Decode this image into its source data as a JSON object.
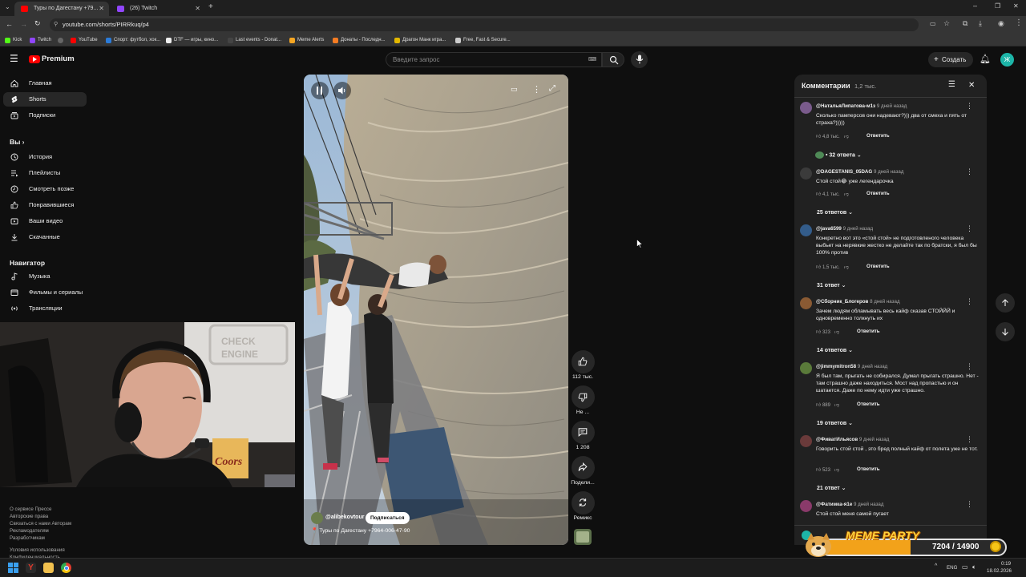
{
  "browser": {
    "tabs": [
      {
        "title": "Туры по Дагестану +79...",
        "active": true
      },
      {
        "title": "(26) Twitch",
        "active": false
      }
    ],
    "url": "youtube.com/shorts/PIRRkuq/p4",
    "bookmarks": [
      "Kick",
      "Twitch",
      "YouTube",
      "Спорт: футбол, хок...",
      "DTF — игры, кино...",
      "Last events - Donat...",
      "Meme Alerts",
      "Донаты - Последн...",
      "Драгон Манк игра...",
      "Free, Fast & Secure..."
    ]
  },
  "youtube": {
    "logo_text": "Premium",
    "search_placeholder": "Введите запрос",
    "create_label": "Создать",
    "avatar_letter": "Ж"
  },
  "sidebar": {
    "main": [
      {
        "label": "Главная",
        "icon": "home-icon"
      },
      {
        "label": "Shorts",
        "icon": "shorts-icon",
        "active": true
      },
      {
        "label": "Подписки",
        "icon": "subscriptions-icon"
      }
    ],
    "you_heading": "Вы",
    "you_items": [
      {
        "label": "История",
        "icon": "history-icon"
      },
      {
        "label": "Плейлисты",
        "icon": "playlists-icon"
      },
      {
        "label": "Смотреть позже",
        "icon": "watch-later-icon"
      },
      {
        "label": "Понравившиеся",
        "icon": "like-icon"
      },
      {
        "label": "Ваши видео",
        "icon": "your-videos-icon"
      },
      {
        "label": "Скачанные",
        "icon": "download-icon"
      }
    ],
    "navigator_heading": "Навигатор",
    "navigator_items": [
      {
        "label": "Музыка",
        "icon": "music-icon"
      },
      {
        "label": "Фильмы и сериалы",
        "icon": "movies-icon"
      },
      {
        "label": "Трансляции",
        "icon": "live-icon"
      }
    ],
    "footer": {
      "line1": "О сервисе   Прессе",
      "line2": "Авторские права",
      "line3": "Связаться с нами   Авторам",
      "line4": "Рекламодателям",
      "line5": "Разработчикам",
      "line6": "Условия использования",
      "line7": "Конфиденциальность"
    }
  },
  "video": {
    "channel": "@alibekovtour",
    "subscribe_label": "Подписаться",
    "caption": "📍 Туры по Дагестану +7964-006-47-90"
  },
  "actions": {
    "likes": "112 тыс.",
    "dislike": "Не ...",
    "comments": "1 208",
    "share": "Подели...",
    "remix": "Ремикс"
  },
  "comments": {
    "title": "Комментарии",
    "count": "1,2 тыс.",
    "reply_label": "Ответить",
    "items": [
      {
        "author": "@НатальяЛипатова-м1з",
        "time": "9 дней назад",
        "text": "Сколько памперсов они надевают?))) два от смеха и пять от страха?)))))",
        "likes": "4,8 тыс.",
        "replies": "32 ответа"
      },
      {
        "author": "@DAGESTANIS_05DAG",
        "time": "9 дней назад",
        "text": "Стой стой😂 уже легендарочка",
        "likes": "4,1 тыс.",
        "replies": "25 ответов"
      },
      {
        "author": "@java6599",
        "time": "9 дней назад",
        "text": "Конкретно вот это «стой стой» не подготовленого человека выбьет на нерявкие жестко      не делайте так по братски, я был бы 100% против",
        "likes": "1,5 тыс.",
        "replies": "31 ответ"
      },
      {
        "author": "@Сборник_Блогеров",
        "time": "8 дней назад",
        "text": "Зачем людям обламывать весь кайф сказав СТОЙЙЙ и одновременно толкнуть их",
        "likes": "323",
        "replies": "14 ответов"
      },
      {
        "author": "@jimmymitron58",
        "time": "9 дней назад",
        "text": "Я был там, прыгать не собирался. Думал прыгать страшно. Нет - там страшно даже находиться. Мост над пропастью и он шатается. Даже по нему идти уже страшно.",
        "likes": "889",
        "replies": "19 ответов"
      },
      {
        "author": "@ФиватИльясов",
        "time": "9 дней назад",
        "text": "Говорить стой стой , это бред полный кайф от полета уже не тот.",
        "likes": "523",
        "replies": "21 ответ"
      },
      {
        "author": "@Фатимка-я1е",
        "time": "9 дней назад",
        "text": "Стой стой  меня самой пугает",
        "likes": "",
        "replies": ""
      }
    ]
  },
  "overlay": {
    "meme_title": "MEME PARTY",
    "meme_count": "7204 / 14900"
  },
  "taskbar": {
    "lang": "ENG",
    "time": "0:19",
    "date": "18.02.2026"
  }
}
